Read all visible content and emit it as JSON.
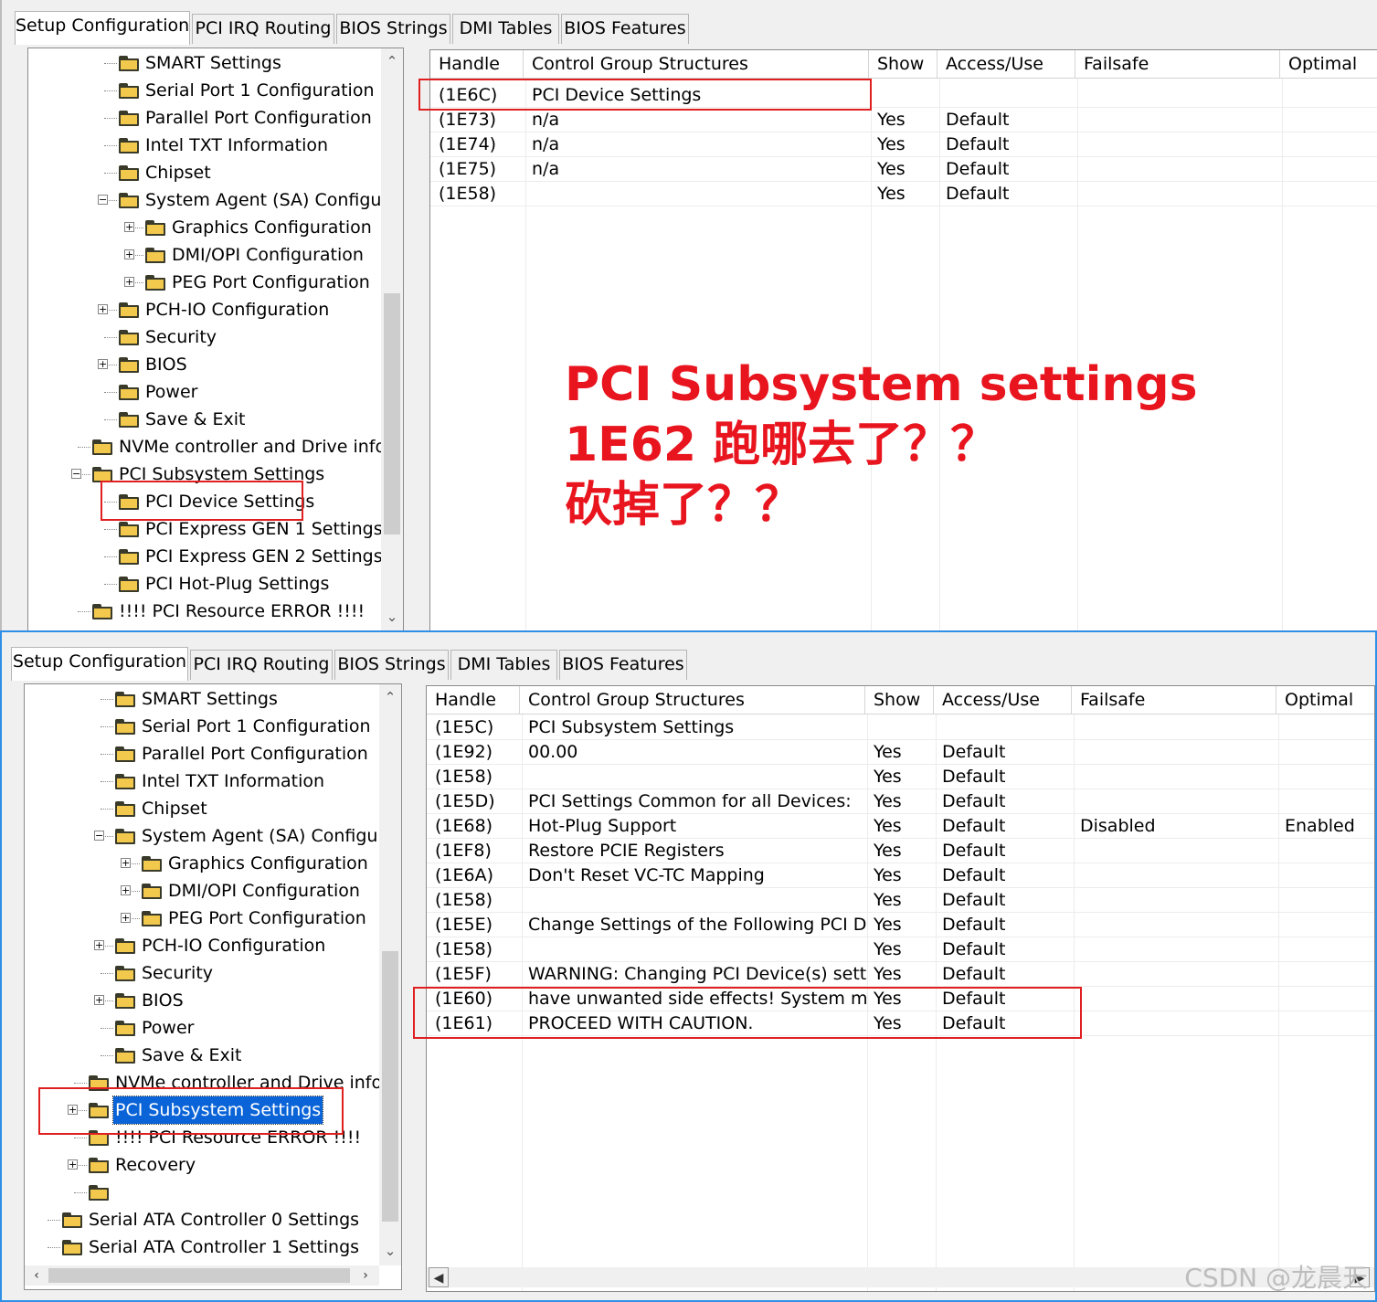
{
  "tabs": [
    "Setup Configuration",
    "PCI IRQ Routing",
    "BIOS Strings",
    "DMI Tables",
    "BIOS Features"
  ],
  "columns": [
    "Handle",
    "Control Group Structures",
    "Show",
    "Access/Use",
    "Failsafe",
    "Optimal"
  ],
  "top_panel": {
    "tree": [
      "SMART Settings",
      "Serial Port 1 Configuration",
      "Parallel Port Configuration",
      "Intel TXT Information",
      "Chipset",
      "System Agent (SA) Configuration",
      "Graphics Configuration",
      "DMI/OPI Configuration",
      "PEG Port Configuration",
      "PCH-IO Configuration",
      "Security",
      "BIOS",
      "Power",
      "Save & Exit",
      "NVMe controller and Drive information",
      "PCI Subsystem Settings",
      "PCI Device Settings",
      "PCI Express GEN 1 Settings",
      "PCI Express GEN 2 Settings",
      "PCI Hot-Plug Settings",
      "!!!! PCI Resource ERROR !!!!"
    ],
    "rows": [
      [
        "(1E6C)",
        "PCI Device Settings",
        "",
        "",
        "",
        ""
      ],
      [
        "(1E73)",
        "n/a",
        "Yes",
        "Default",
        "",
        ""
      ],
      [
        "(1E74)",
        "n/a",
        "Yes",
        "Default",
        "",
        ""
      ],
      [
        "(1E75)",
        "n/a",
        "Yes",
        "Default",
        "",
        ""
      ],
      [
        "(1E58)",
        "",
        "Yes",
        "Default",
        "",
        ""
      ]
    ]
  },
  "bottom_panel": {
    "tree": [
      "SMART Settings",
      "Serial Port 1 Configuration",
      "Parallel Port Configuration",
      "Intel TXT Information",
      "Chipset",
      "System Agent (SA) Configuration",
      "Graphics Configuration",
      "DMI/OPI Configuration",
      "PEG Port Configuration",
      "PCH-IO Configuration",
      "Security",
      "BIOS",
      "Power",
      "Save & Exit",
      "NVMe controller and Drive information",
      "PCI Subsystem Settings",
      "!!!! PCI Resource ERROR !!!!",
      "Recovery",
      "",
      "Serial ATA Controller 0 Settings",
      "Serial ATA Controller 1 Settings"
    ],
    "rows": [
      [
        "(1E5C)",
        "PCI Subsystem Settings",
        "",
        "",
        "",
        ""
      ],
      [
        "(1E92)",
        "00.00",
        "Yes",
        "Default",
        "",
        ""
      ],
      [
        "(1E58)",
        "",
        "Yes",
        "Default",
        "",
        ""
      ],
      [
        "(1E5D)",
        "PCI Settings Common for all Devices:",
        "Yes",
        "Default",
        "",
        ""
      ],
      [
        "(1E68)",
        "Hot-Plug Support",
        "Yes",
        "Default",
        "Disabled",
        "Enabled"
      ],
      [
        "(1EF8)",
        "Restore PCIE Registers",
        "Yes",
        "Default",
        "",
        ""
      ],
      [
        "(1E6A)",
        "Don't Reset VC-TC Mapping",
        "Yes",
        "Default",
        "",
        ""
      ],
      [
        "(1E58)",
        "",
        "Yes",
        "Default",
        "",
        ""
      ],
      [
        "(1E5E)",
        "Change Settings of the Following PCI D...",
        "Yes",
        "Default",
        "",
        ""
      ],
      [
        "(1E58)",
        "",
        "Yes",
        "Default",
        "",
        ""
      ],
      [
        "(1E5F)",
        "WARNING: Changing PCI Device(s) setti...",
        "Yes",
        "Default",
        "",
        ""
      ],
      [
        "(1E60)",
        "have unwanted side effects! System ma...",
        "Yes",
        "Default",
        "",
        ""
      ],
      [
        "(1E61)",
        "PROCEED WITH CAUTION.",
        "Yes",
        "Default",
        "",
        ""
      ]
    ]
  },
  "annotation": {
    "line1": "PCI Subsystem settings",
    "line2": "1E62 跑哪去了？？",
    "line3": "砍掉了？？",
    "color": "#e8141e"
  },
  "watermark": "CSDN @龙晨天",
  "icons": [
    "folder-icon",
    "folder-open-icon",
    "expand-plus-icon",
    "collapse-minus-icon",
    "scroll-up-icon",
    "scroll-down-icon",
    "scroll-left-icon",
    "scroll-right-icon"
  ],
  "colors": {
    "highlight_box": "#e02020",
    "selection": "#0a64d8",
    "panel_border": "#2f8fe6"
  }
}
